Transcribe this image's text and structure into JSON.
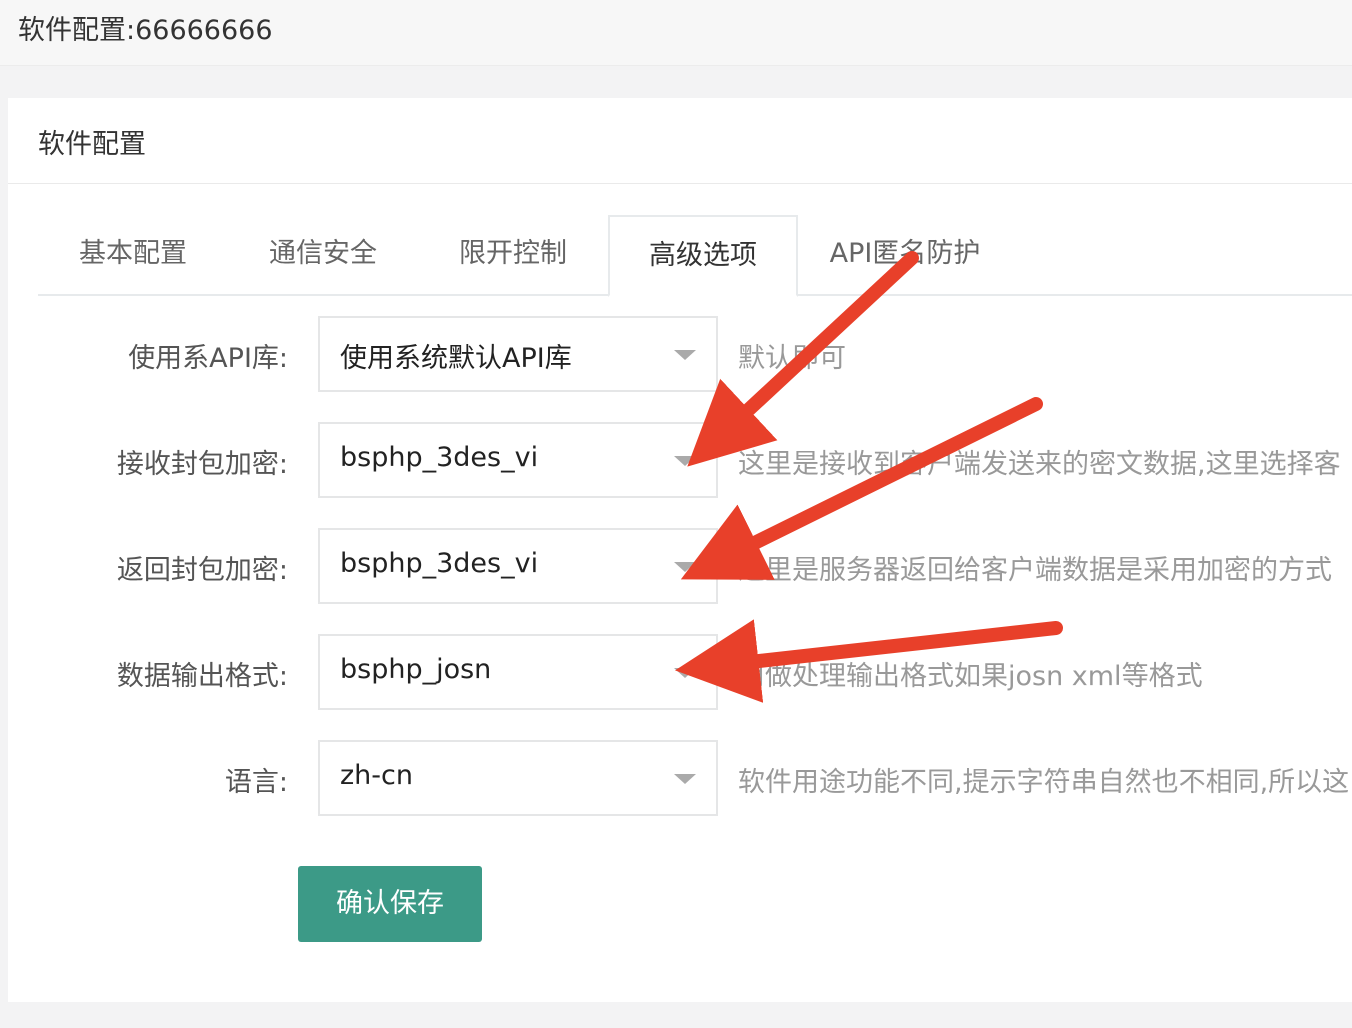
{
  "page": {
    "title": "软件配置:66666666"
  },
  "panel": {
    "title": "软件配置"
  },
  "tabs": [
    {
      "label": "基本配置",
      "active": false
    },
    {
      "label": "通信安全",
      "active": false
    },
    {
      "label": "限开控制",
      "active": false
    },
    {
      "label": "高级选项",
      "active": true
    },
    {
      "label": "API匿名防护",
      "active": false
    }
  ],
  "form": {
    "rows": [
      {
        "label": "使用系API库:",
        "value": "使用系统默认API库",
        "hint": "默认即可"
      },
      {
        "label": "接收封包加密:",
        "value": "bsphp_3des_vi",
        "hint": "这里是接收到客户端发送来的密文数据,这里选择客"
      },
      {
        "label": "返回封包加密:",
        "value": "bsphp_3des_vi",
        "hint": "这里是服务器返回给客户端数据是采用加密的方式"
      },
      {
        "label": "数据输出格式:",
        "value": "bsphp_josn",
        "hint": "用做处理输出格式如果josn xml等格式"
      },
      {
        "label": "语言:",
        "value": "zh-cn",
        "hint": "软件用途功能不同,提示字符串自然也不相同,所以这"
      }
    ],
    "save_label": "确认保存"
  },
  "colors": {
    "accent": "#3c9a87",
    "annotation_arrow": "#e8402a"
  }
}
